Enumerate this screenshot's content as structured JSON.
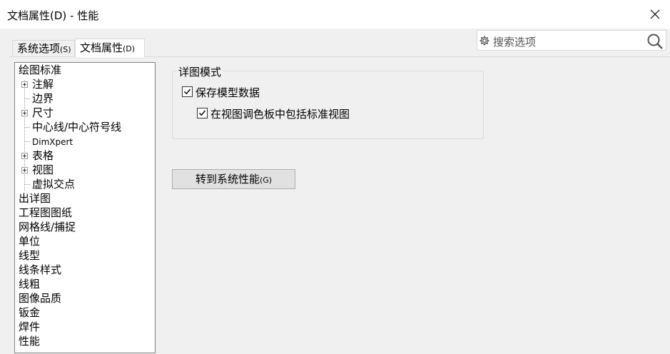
{
  "window": {
    "title": "文档属性(D) - 性能"
  },
  "tabs": [
    {
      "label": "系统选项",
      "accel": "(S)"
    },
    {
      "label": "文档属性",
      "accel": "(D)"
    }
  ],
  "search": {
    "placeholder": "搜索选项"
  },
  "tree": {
    "items": [
      {
        "label": "绘图标准"
      },
      {
        "label": "注解"
      },
      {
        "label": "边界"
      },
      {
        "label": "尺寸"
      },
      {
        "label": "中心线/中心符号线"
      },
      {
        "label": "DimXpert"
      },
      {
        "label": "表格"
      },
      {
        "label": "视图"
      },
      {
        "label": "虚拟交点"
      },
      {
        "label": "出详图"
      },
      {
        "label": "工程图图纸"
      },
      {
        "label": "网格线/捕捉"
      },
      {
        "label": "单位"
      },
      {
        "label": "线型"
      },
      {
        "label": "线条样式"
      },
      {
        "label": "线粗"
      },
      {
        "label": "图像品质"
      },
      {
        "label": "钣金"
      },
      {
        "label": "焊件"
      },
      {
        "label": "性能"
      }
    ]
  },
  "detail_mode": {
    "legend": "详图模式",
    "save_model_data": {
      "label": "保存模型数据",
      "checked": true
    },
    "include_standard_views": {
      "label": "在视图调色板中包括标准视图",
      "checked": true
    }
  },
  "goto_button": {
    "label": "转到系统性能",
    "accel": "(G)"
  }
}
